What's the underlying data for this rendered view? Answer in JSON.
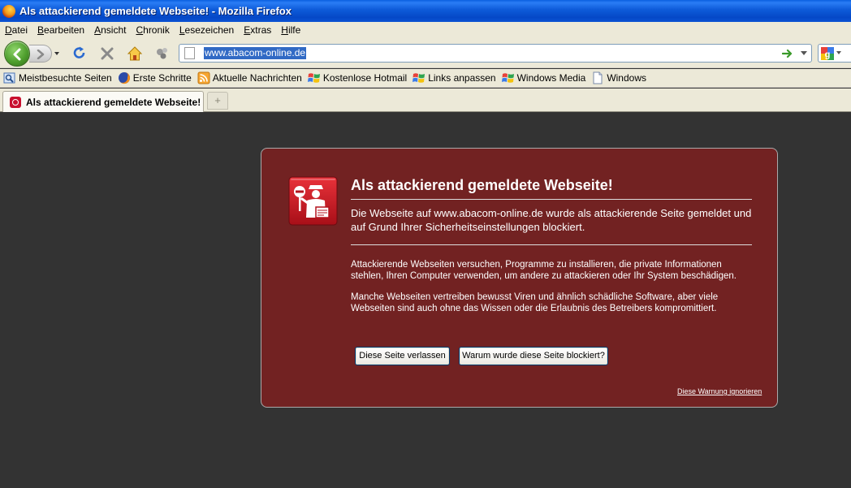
{
  "window": {
    "title": "Als attackierend gemeldete Webseite! - Mozilla Firefox"
  },
  "menu": [
    {
      "ul": "D",
      "rest": "atei"
    },
    {
      "ul": "B",
      "rest": "earbeiten"
    },
    {
      "ul": "A",
      "rest": "nsicht"
    },
    {
      "ul": "C",
      "rest": "hronik"
    },
    {
      "ul": "L",
      "rest": "esezeichen"
    },
    {
      "ul": "E",
      "rest": "xtras"
    },
    {
      "ul": "H",
      "rest": "ilfe"
    }
  ],
  "navbar": {
    "url": "www.abacom-online.de"
  },
  "bookmarks": [
    {
      "label": "Meistbesuchte Seiten",
      "icon": "smart-bookmark-icon"
    },
    {
      "label": "Erste Schritte",
      "icon": "firefox-icon"
    },
    {
      "label": "Aktuelle Nachrichten",
      "icon": "rss-feed-icon"
    },
    {
      "label": "Kostenlose Hotmail",
      "icon": "windows-flag-icon"
    },
    {
      "label": "Links anpassen",
      "icon": "windows-flag-icon"
    },
    {
      "label": "Windows Media",
      "icon": "windows-flag-icon"
    },
    {
      "label": "Windows",
      "icon": "page-icon"
    }
  ],
  "tab": {
    "label": "Als attackierend gemeldete Webseite!",
    "new_tab": "+"
  },
  "error": {
    "title": "Als attackierend gemeldete Webseite!",
    "short_desc": "Die Webseite auf www.abacom-online.de wurde als attackierende Seite gemeldet und auf Grund Ihrer Sicherheitseinstellungen blockiert.",
    "long_desc_1": "Attackierende Webseiten versuchen, Programme zu installieren, die private Informationen stehlen, Ihren Computer verwenden, um andere zu attackieren oder Ihr System beschädigen.",
    "long_desc_2": "Manche Webseiten vertreiben bewusst Viren und ähnlich schädliche Software, aber viele Webseiten sind auch ohne das Wissen oder die Erlaubnis des Betreibers kompromittiert.",
    "button_leave": "Diese Seite verlassen",
    "button_why": "Warum wurde diese Seite blockiert?",
    "ignore_link": "Diese Warnung ignorieren"
  },
  "colors": {
    "error_bg": "#722222",
    "content_bg": "#333333",
    "titlebar": "#0a52d4"
  }
}
